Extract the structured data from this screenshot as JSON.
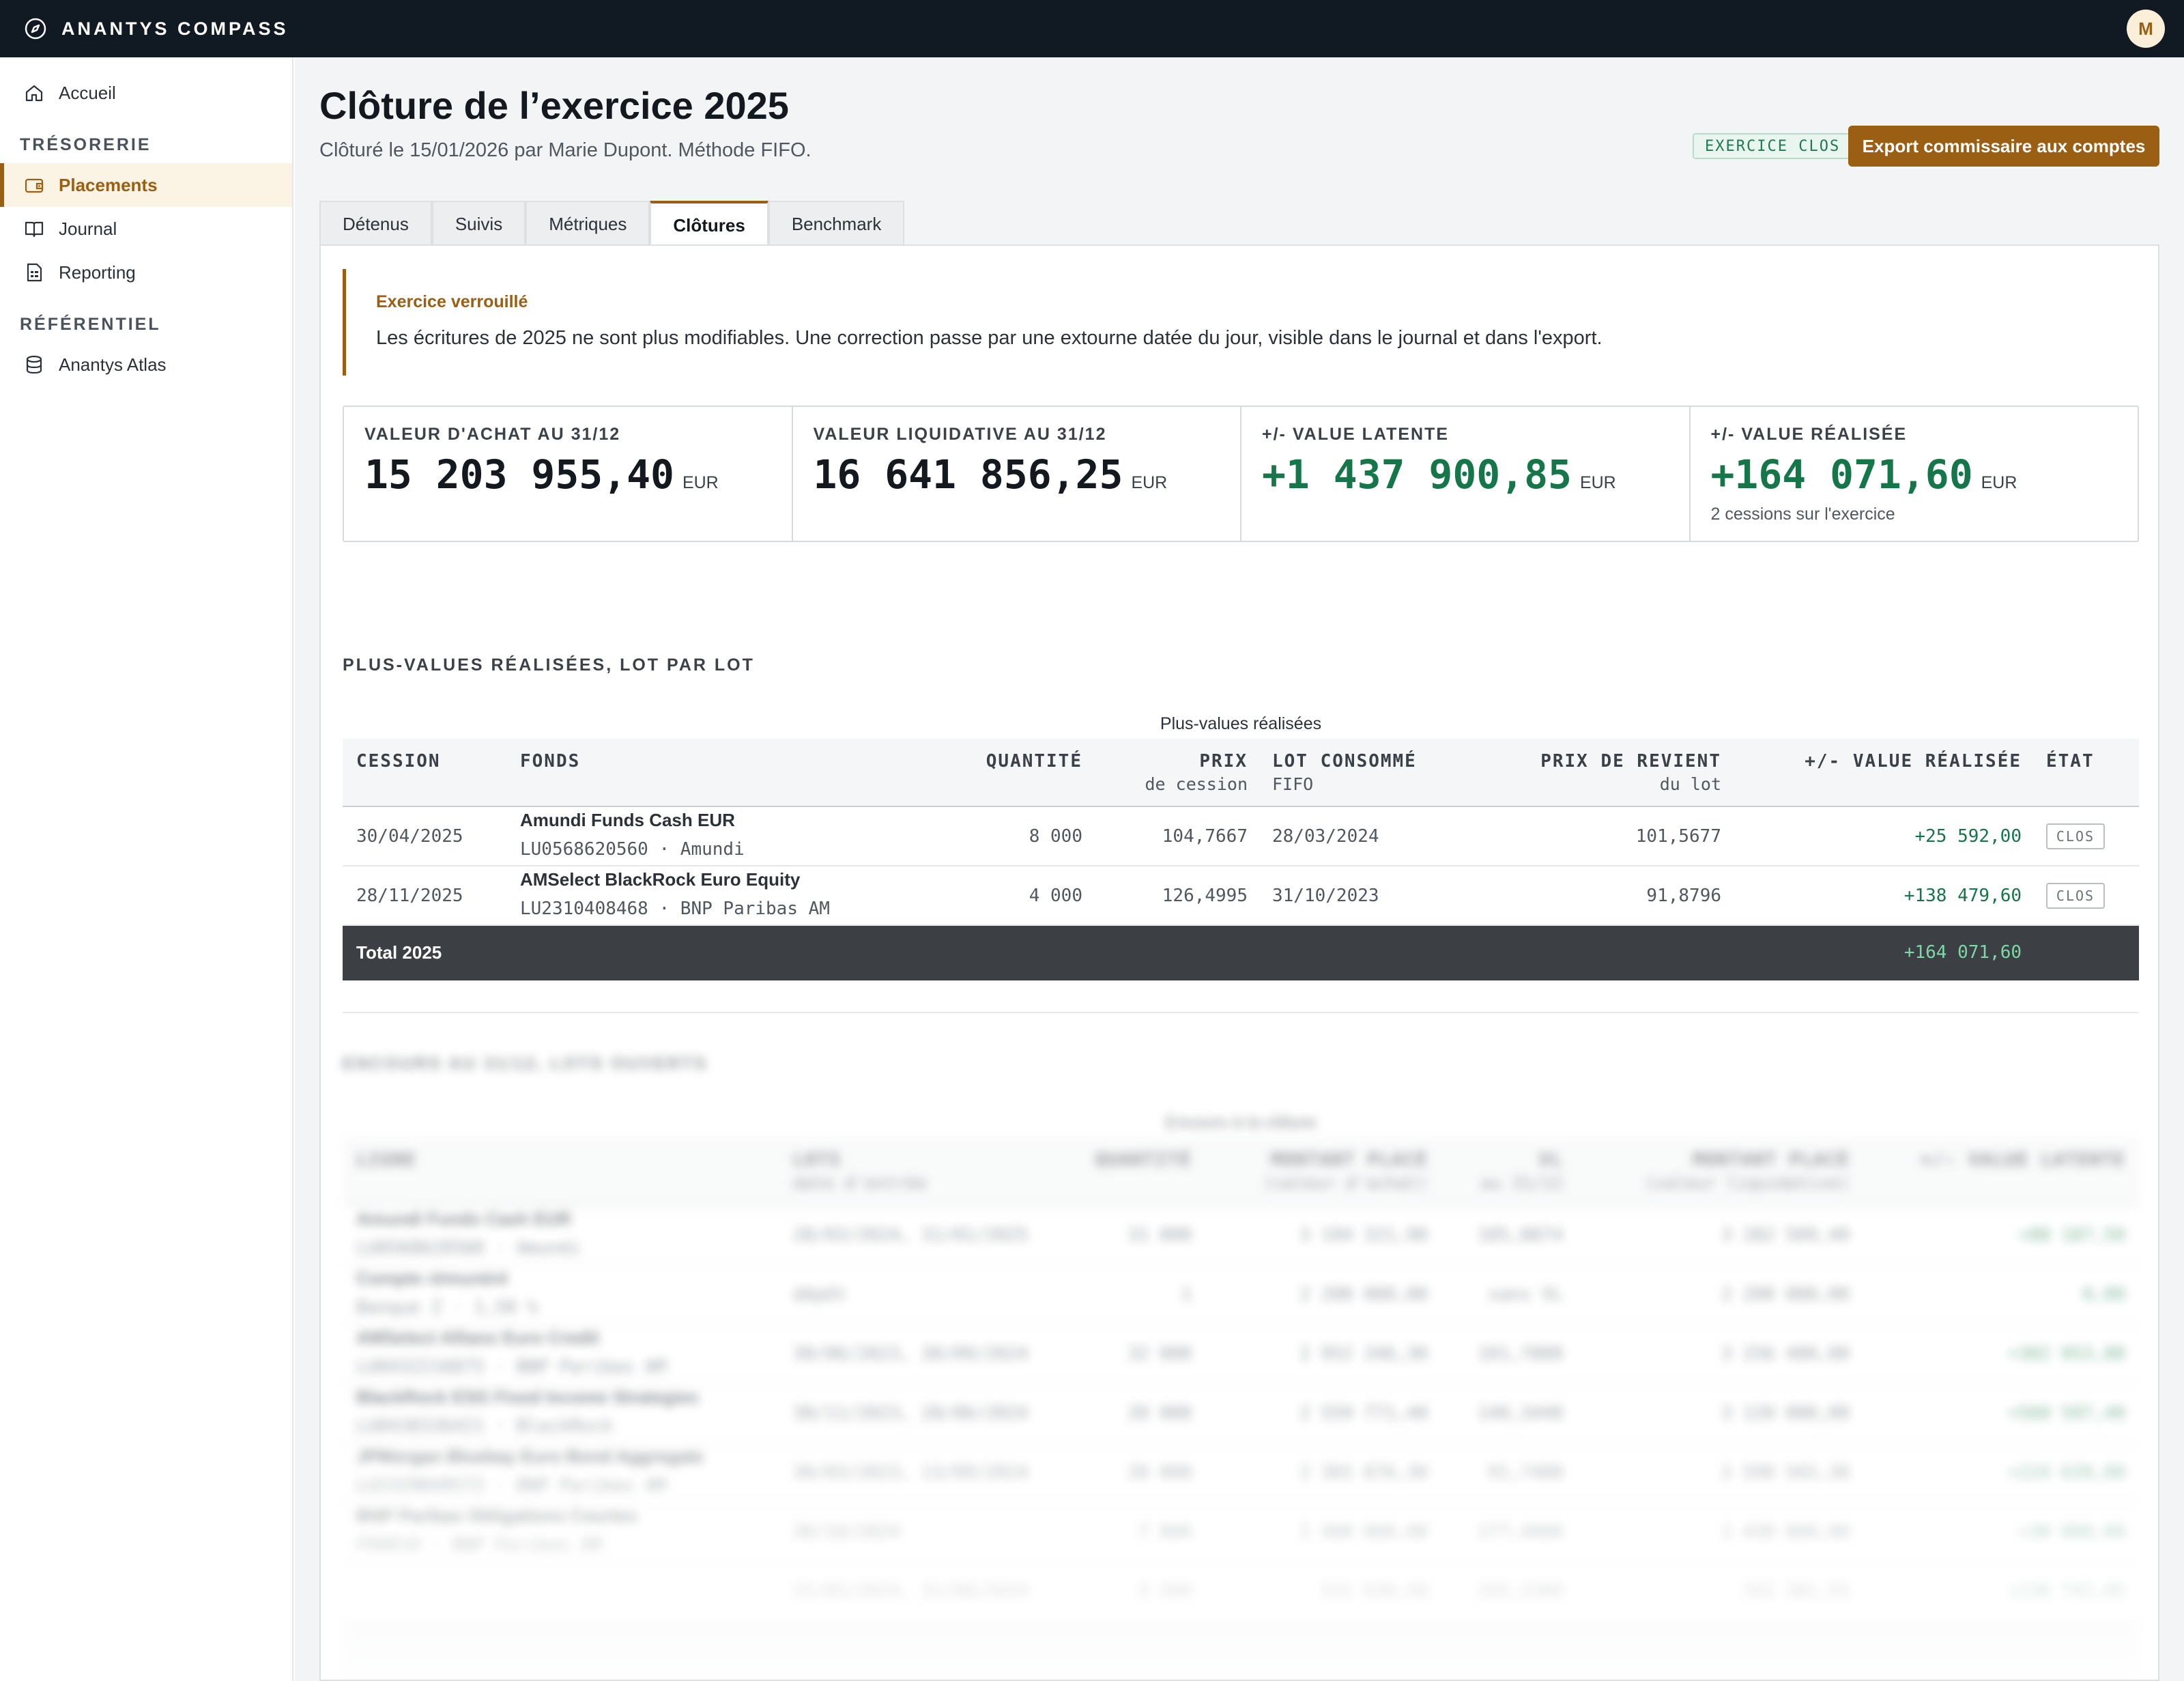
{
  "app": {
    "brand": "ANANTYS COMPASS",
    "avatar_initial": "M"
  },
  "sidebar": {
    "home": "Accueil",
    "section_treasury": "TRÉSORERIE",
    "placements": "Placements",
    "journal": "Journal",
    "reporting": "Reporting",
    "section_ref": "RÉFÉRENTIEL",
    "atlas": "Anantys Atlas"
  },
  "header": {
    "title": "Clôture de l’exercice 2025",
    "subtitle": "Clôturé le 15/01/2026 par Marie Dupont. Méthode FIFO.",
    "badge": "EXERCICE CLOS",
    "export_label": "Export commissaire aux comptes"
  },
  "tabs": [
    {
      "label": "Détenus"
    },
    {
      "label": "Suivis"
    },
    {
      "label": "Métriques"
    },
    {
      "label": "Clôtures"
    },
    {
      "label": "Benchmark"
    }
  ],
  "lock": {
    "title": "Exercice verrouillé",
    "text": "Les écritures de 2025 ne sont plus modifiables. Une correction passe par une extourne datée du jour, visible dans le journal et dans l'export."
  },
  "kpis": [
    {
      "label": "VALEUR D'ACHAT AU 31/12",
      "value": "15 203 955,40",
      "unit": "EUR",
      "foot": ""
    },
    {
      "label": "VALEUR LIQUIDATIVE AU 31/12",
      "value": "16 641 856,25",
      "unit": "EUR",
      "foot": ""
    },
    {
      "label": "+/- VALUE LATENTE",
      "value": "+1 437 900,85",
      "unit": "EUR",
      "foot": ""
    },
    {
      "label": "+/- VALUE RÉALISÉE",
      "value": "+164 071,60",
      "unit": "EUR",
      "foot": "2 cessions sur l'exercice"
    }
  ],
  "realized": {
    "section_title": "PLUS-VALUES RÉALISÉES, LOT PAR LOT",
    "caption": "Plus-values réalisées",
    "headers": {
      "cession": "CESSION",
      "fonds": "FONDS",
      "quantite": "QUANTITÉ",
      "prix": "PRIX",
      "prix_sub": "de cession",
      "lot": "LOT CONSOMMÉ",
      "lot_sub": "FIFO",
      "revient": "PRIX DE REVIENT",
      "revient_sub": "du lot",
      "value": "+/- VALUE RÉALISÉE",
      "etat": "ÉTAT"
    },
    "rows": [
      {
        "cession": "30/04/2025",
        "fund": "Amundi Funds Cash EUR",
        "fund_sub": "LU0568620560 · Amundi",
        "qty": "8 000",
        "price": "104,7667",
        "lot": "28/03/2024",
        "cost": "101,5677",
        "value": "+25 592,00",
        "etat": "CLOS"
      },
      {
        "cession": "28/11/2025",
        "fund": "AMSelect BlackRock Euro Equity",
        "fund_sub": "LU2310408468 · BNP Paribas AM",
        "qty": "4 000",
        "price": "126,4995",
        "lot": "31/10/2023",
        "cost": "91,8796",
        "value": "+138 479,60",
        "etat": "CLOS"
      }
    ],
    "total_label": "Total 2025",
    "total_value": "+164 071,60"
  },
  "open_lots": {
    "section_title": "ENCOURS AU 31/12, LOTS OUVERTS",
    "caption": "Encours à la clôture",
    "headers": {
      "ligne": "LIGNE",
      "lots": "LOTS",
      "lots_sub": "date d'entrée",
      "quantite": "QUANTITÉ",
      "montant": "MONTANT PLACÉ",
      "montant_sub": "(valeur d'achat)",
      "vl": "VL",
      "vl_sub": "au 31/12",
      "montant2": "MONTANT PLACÉ",
      "montant2_sub": "(valeur liquidative)",
      "latente": "+/- VALUE LATENTE"
    },
    "rows": [
      {
        "name": "Amundi Funds Cash EUR",
        "sub": "LU0568620560 · Amundi",
        "lots": "28/03/2024, 31/01/2025",
        "qty": "31 000",
        "m1": "3 194 321,90",
        "vl": "105,8874",
        "m2": "3 282 509,40",
        "lat": "+88 187,50"
      },
      {
        "name": "Compte rémunéré",
        "sub": "Banque Z · 1,50 %",
        "lots": "dépôt",
        "qty": "1",
        "m1": "2 200 000,00",
        "vl": "sans VL",
        "m2": "2 200 000,00",
        "lat": "0,00"
      },
      {
        "name": "AMSelect Allianz Euro Credit",
        "sub": "LU0432216875 · BNP Paribas AM",
        "lots": "30/06/2023, 30/09/2024",
        "qty": "32 000",
        "m1": "2 952 346,30",
        "vl": "101,7800",
        "m2": "3 256 400,00",
        "lat": "+302 053,80"
      },
      {
        "name": "BlackRock ESG Fixed Income Strategies",
        "sub": "LU0438336421 · BlackRock",
        "lots": "30/11/2023, 28/06/2024",
        "qty": "20 000",
        "m1": "2 559 771,40",
        "vl": "140,3440",
        "m2": "3 120 000,00",
        "lat": "+560 597,40"
      },
      {
        "name": "JPMorgan Bluebay Euro Bond Aggregate",
        "sub": "LU2329849572 · BNP Paribas AM",
        "lots": "30/03/2023, 13/09/2024",
        "qty": "28 000",
        "m1": "2 365 876,30",
        "vl": "91,7400",
        "m2": "2 590 565,30",
        "lat": "+224 639,00"
      },
      {
        "name": "BNP Paribas Obligations Courtes",
        "sub": "FR0010 · BNP Paribas AM",
        "lots": "30/10/2024",
        "qty": "7 000",
        "m1": "1 400 000,00",
        "vl": "177,4900",
        "m2": "1 430 000,00",
        "lat": "+30 000,00"
      },
      {
        "name": "",
        "sub": "",
        "lots": "31/05/2024, 31/08/2024",
        "qty": "3 500",
        "m1": "531 639,50",
        "vl": "165,2300",
        "m2": "762 381,55",
        "lat": "+230 742,05"
      }
    ]
  }
}
